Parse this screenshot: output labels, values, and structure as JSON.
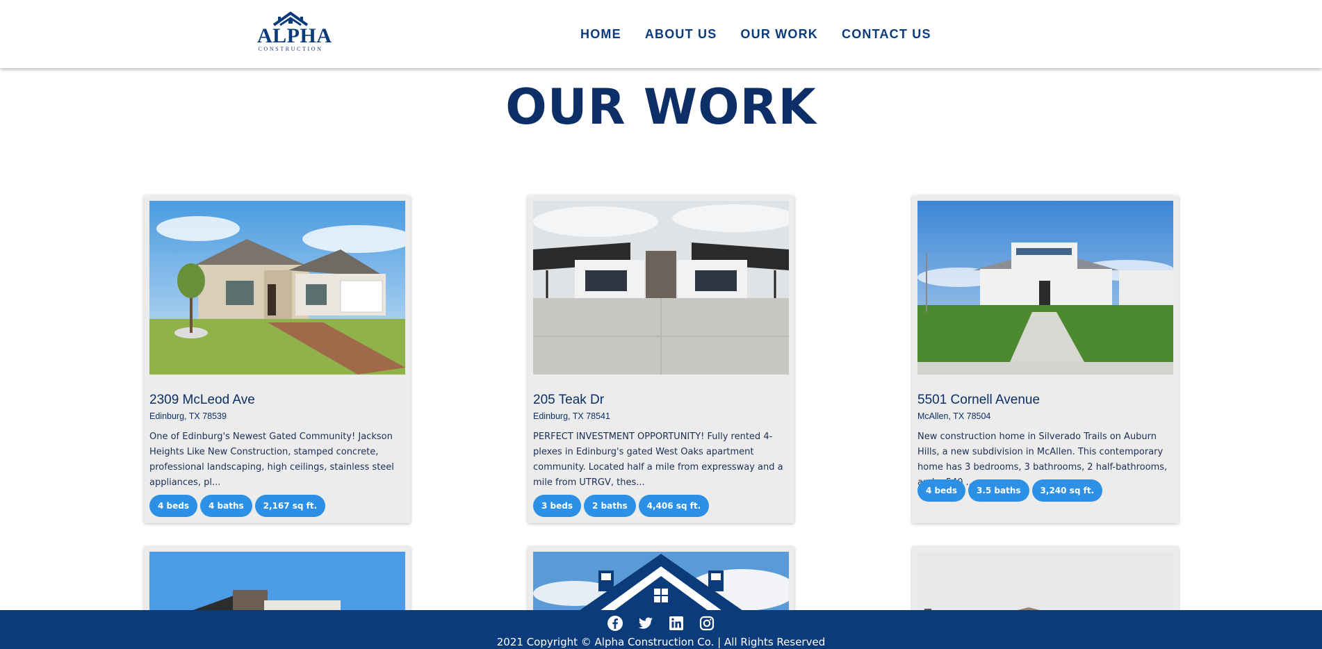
{
  "header": {
    "logo": {
      "word": "ALPHA",
      "sub": "CONSTRUCTION"
    },
    "nav": [
      {
        "label": "HOME"
      },
      {
        "label": "ABOUT US"
      },
      {
        "label": "OUR WORK"
      },
      {
        "label": "CONTACT US"
      }
    ]
  },
  "page_title": "OUR WORK",
  "listings": [
    {
      "address": "2309 McLeod Ave",
      "city": "Edinburg, TX 78539",
      "description": "One of Edinburg's Newest Gated Community! Jackson Heights Like New Construction, stamped concrete, professional landscaping, high ceilings, stainless steel appliances, pl...",
      "beds": "4 beds",
      "baths": "4 baths",
      "sqft": "2,167 sq ft."
    },
    {
      "address": "205 Teak Dr",
      "city": "Edinburg, TX 78541",
      "description": "PERFECT INVESTMENT OPPORTUNITY! Fully rented 4-plexes in Edinburg's gated West Oaks apartment community. Located half a mile from expressway and a mile from UTRGV, thes...",
      "beds": "3 beds",
      "baths": "2 baths",
      "sqft": "4,406 sq ft."
    },
    {
      "address": "5501 Cornell Avenue",
      "city": "McAllen, TX 78504",
      "description": "New construction home in Silverado Trails on Auburn Hills, a new subdivision in McAllen. This contemporary home has 3 bedrooms, 3 bathrooms, 2 half-bathrooms, and a 540 ...",
      "beds": "4 beds",
      "baths": "3.5 baths",
      "sqft": "3,240 sq ft."
    }
  ],
  "footer": {
    "socials": [
      "facebook-icon",
      "twitter-icon",
      "linkedin-icon",
      "instagram-icon"
    ],
    "copyright": "2021 Copyright © Alpha Construction Co. | All Rights Reserved"
  },
  "colors": {
    "brand_navy": "#0b3b7a",
    "pill_blue": "#2b90e6",
    "card_bg": "#ececec"
  }
}
